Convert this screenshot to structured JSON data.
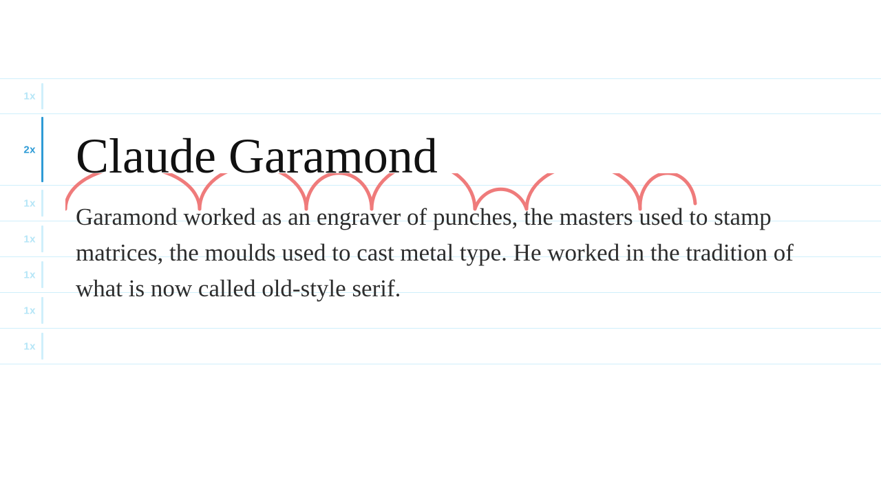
{
  "grid": {
    "unit_labels": [
      "1x",
      "2x",
      "1x",
      "1x",
      "1x",
      "1x",
      "1x"
    ],
    "highlight_index": 1
  },
  "heading": "Claude Garamond",
  "paragraph": "Garamond worked as an engraver of punches, the masters used to stamp matrices, the moulds used to cast metal type. He worked in the tradition of what is now called old-style serif.",
  "colors": {
    "rule": "#cfeffb",
    "highlight": "#2e9bd6",
    "arc": "#ef7b7b"
  }
}
